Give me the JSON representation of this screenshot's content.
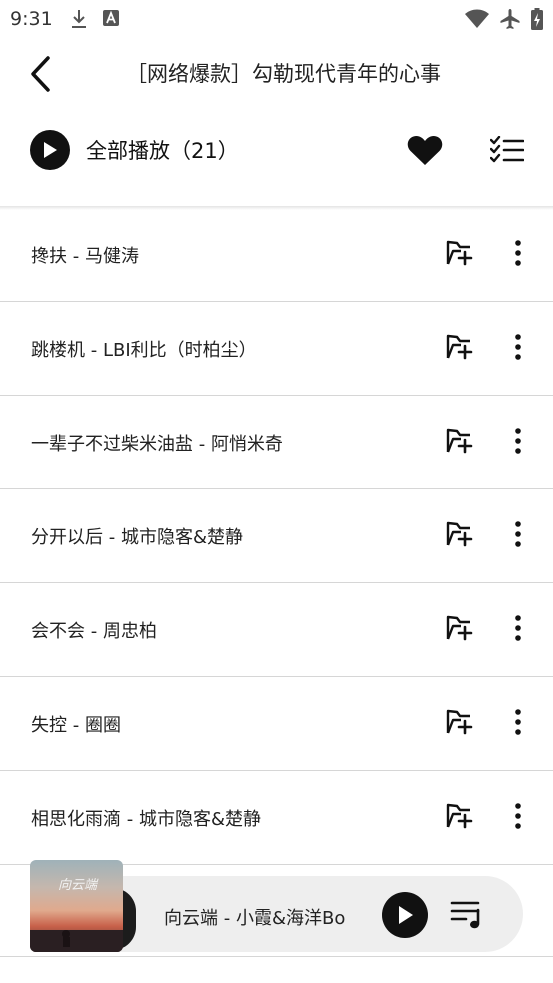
{
  "status_bar": {
    "time": "9:31",
    "left_icons": [
      "download-icon",
      "app-notification-icon"
    ],
    "right_icons": [
      "wifi-icon",
      "airplane-mode-icon",
      "battery-charging-icon"
    ]
  },
  "header": {
    "title": "［网络爆款］勾勒现代青年的心事",
    "back_icon": "back-arrow-icon"
  },
  "toolbar": {
    "play_all_label": "全部播放（21）",
    "favorite_icon": "heart-icon",
    "multi_select_icon": "checklist-icon"
  },
  "songs": [
    {
      "text": "搀扶 - 马健涛"
    },
    {
      "text": "跳楼机 - LBI利比（时柏尘）"
    },
    {
      "text": "一辈子不过柴米油盐 - 阿悄米奇"
    },
    {
      "text": "分开以后 - 城市隐客&楚静"
    },
    {
      "text": "会不会 - 周忠柏"
    },
    {
      "text": "失控 - 圈圈"
    },
    {
      "text": "相思化雨滴 - 城市隐客&楚静"
    }
  ],
  "row_icons": {
    "add": "add-to-playlist-icon",
    "more": "more-vertical-icon"
  },
  "mini_player": {
    "track": "向云端 - 小霞&海洋Bo",
    "cover_text": "向云端",
    "play_icon": "play-icon",
    "queue_icon": "playlist-queue-icon"
  },
  "colors": {
    "accent": "#111111",
    "divider": "#d6d6d6",
    "mini_player_bg": "#eeeeee"
  }
}
